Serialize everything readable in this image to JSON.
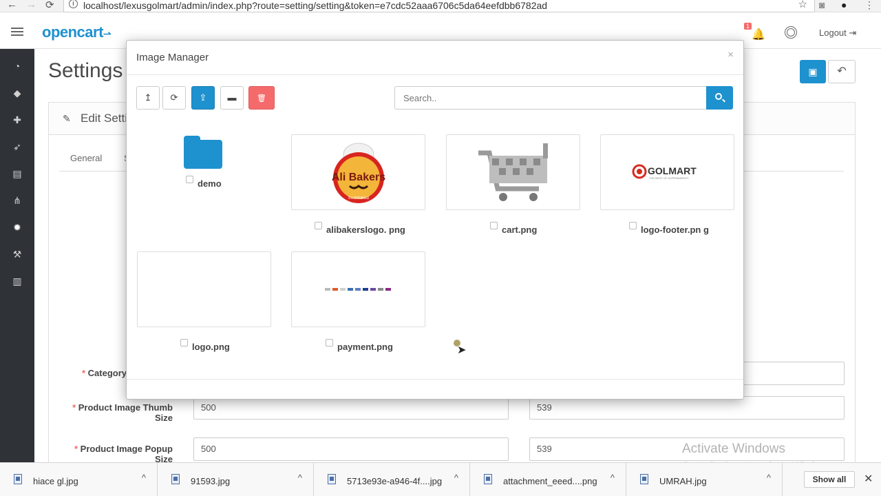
{
  "browser": {
    "url": "localhost/lexusgolmart/admin/index.php?route=setting/setting&token=e7cdc52aaa6706c5da64eefdbb6782ad",
    "back_glyph": "←",
    "forward_glyph": "→",
    "reload_glyph": "⟳",
    "star_glyph": "☆"
  },
  "header": {
    "logo": "opencart",
    "logo_cart": "⇀",
    "notification_count": "1",
    "logout_label": "Logout"
  },
  "sidebar": {
    "icons": [
      "dashboard-icon",
      "tags-icon",
      "puzzle-icon",
      "rocket-icon",
      "cart-icon",
      "share-icon",
      "gear-icon",
      "wrench-icon",
      "chart-icon"
    ],
    "active": "gear-icon"
  },
  "page": {
    "title": "Settings",
    "panel_title": "Edit Setti",
    "tab_general": "General",
    "tab_second": "S",
    "labels": {
      "category": "Category",
      "thumb_line1": "Product Image Thumb",
      "thumb_line2": "Size",
      "popup": "Product Image Popup Size"
    },
    "inputs": {
      "thumb_width": "500",
      "thumb_height": "539",
      "popup_width": "500",
      "popup_height": "539"
    }
  },
  "modal": {
    "title": "Image Manager",
    "close": "×",
    "search_placeholder": "Search..",
    "tools": {
      "parent": "↥",
      "refresh": "⟳",
      "upload": "⇪",
      "folder": "▬",
      "delete": "🗑"
    },
    "items": [
      {
        "name": "demo",
        "kind": "folder"
      },
      {
        "name": "alibakerslogo. png",
        "kind": "image"
      },
      {
        "name": "cart.png",
        "kind": "image"
      },
      {
        "name": "logo-footer.pn g",
        "kind": "image"
      },
      {
        "name": "logo.png",
        "kind": "image"
      },
      {
        "name": "payment.png",
        "kind": "image"
      }
    ],
    "alibakers_text": "Ali Bakers",
    "alibakers_sub": "freshbaked",
    "golmart_text": "GOLMART",
    "golmart_sub": "THE BEST OF SUPERMARKET"
  },
  "watermark": {
    "line1": "Activate Windows",
    "line2": "Go to Settings to activate Windows."
  },
  "downloads": {
    "items": [
      "hiace gl.jpg",
      "91593.jpg",
      "5713e93e-a946-4f....jpg",
      "attachment_eeed....png",
      "UMRAH.jpg"
    ],
    "show_all": "Show all",
    "close": "✕",
    "caret": "^"
  },
  "colors": {
    "primary": "#1e91cf",
    "danger": "#f56b6b",
    "sidebar": "#2f3338"
  }
}
